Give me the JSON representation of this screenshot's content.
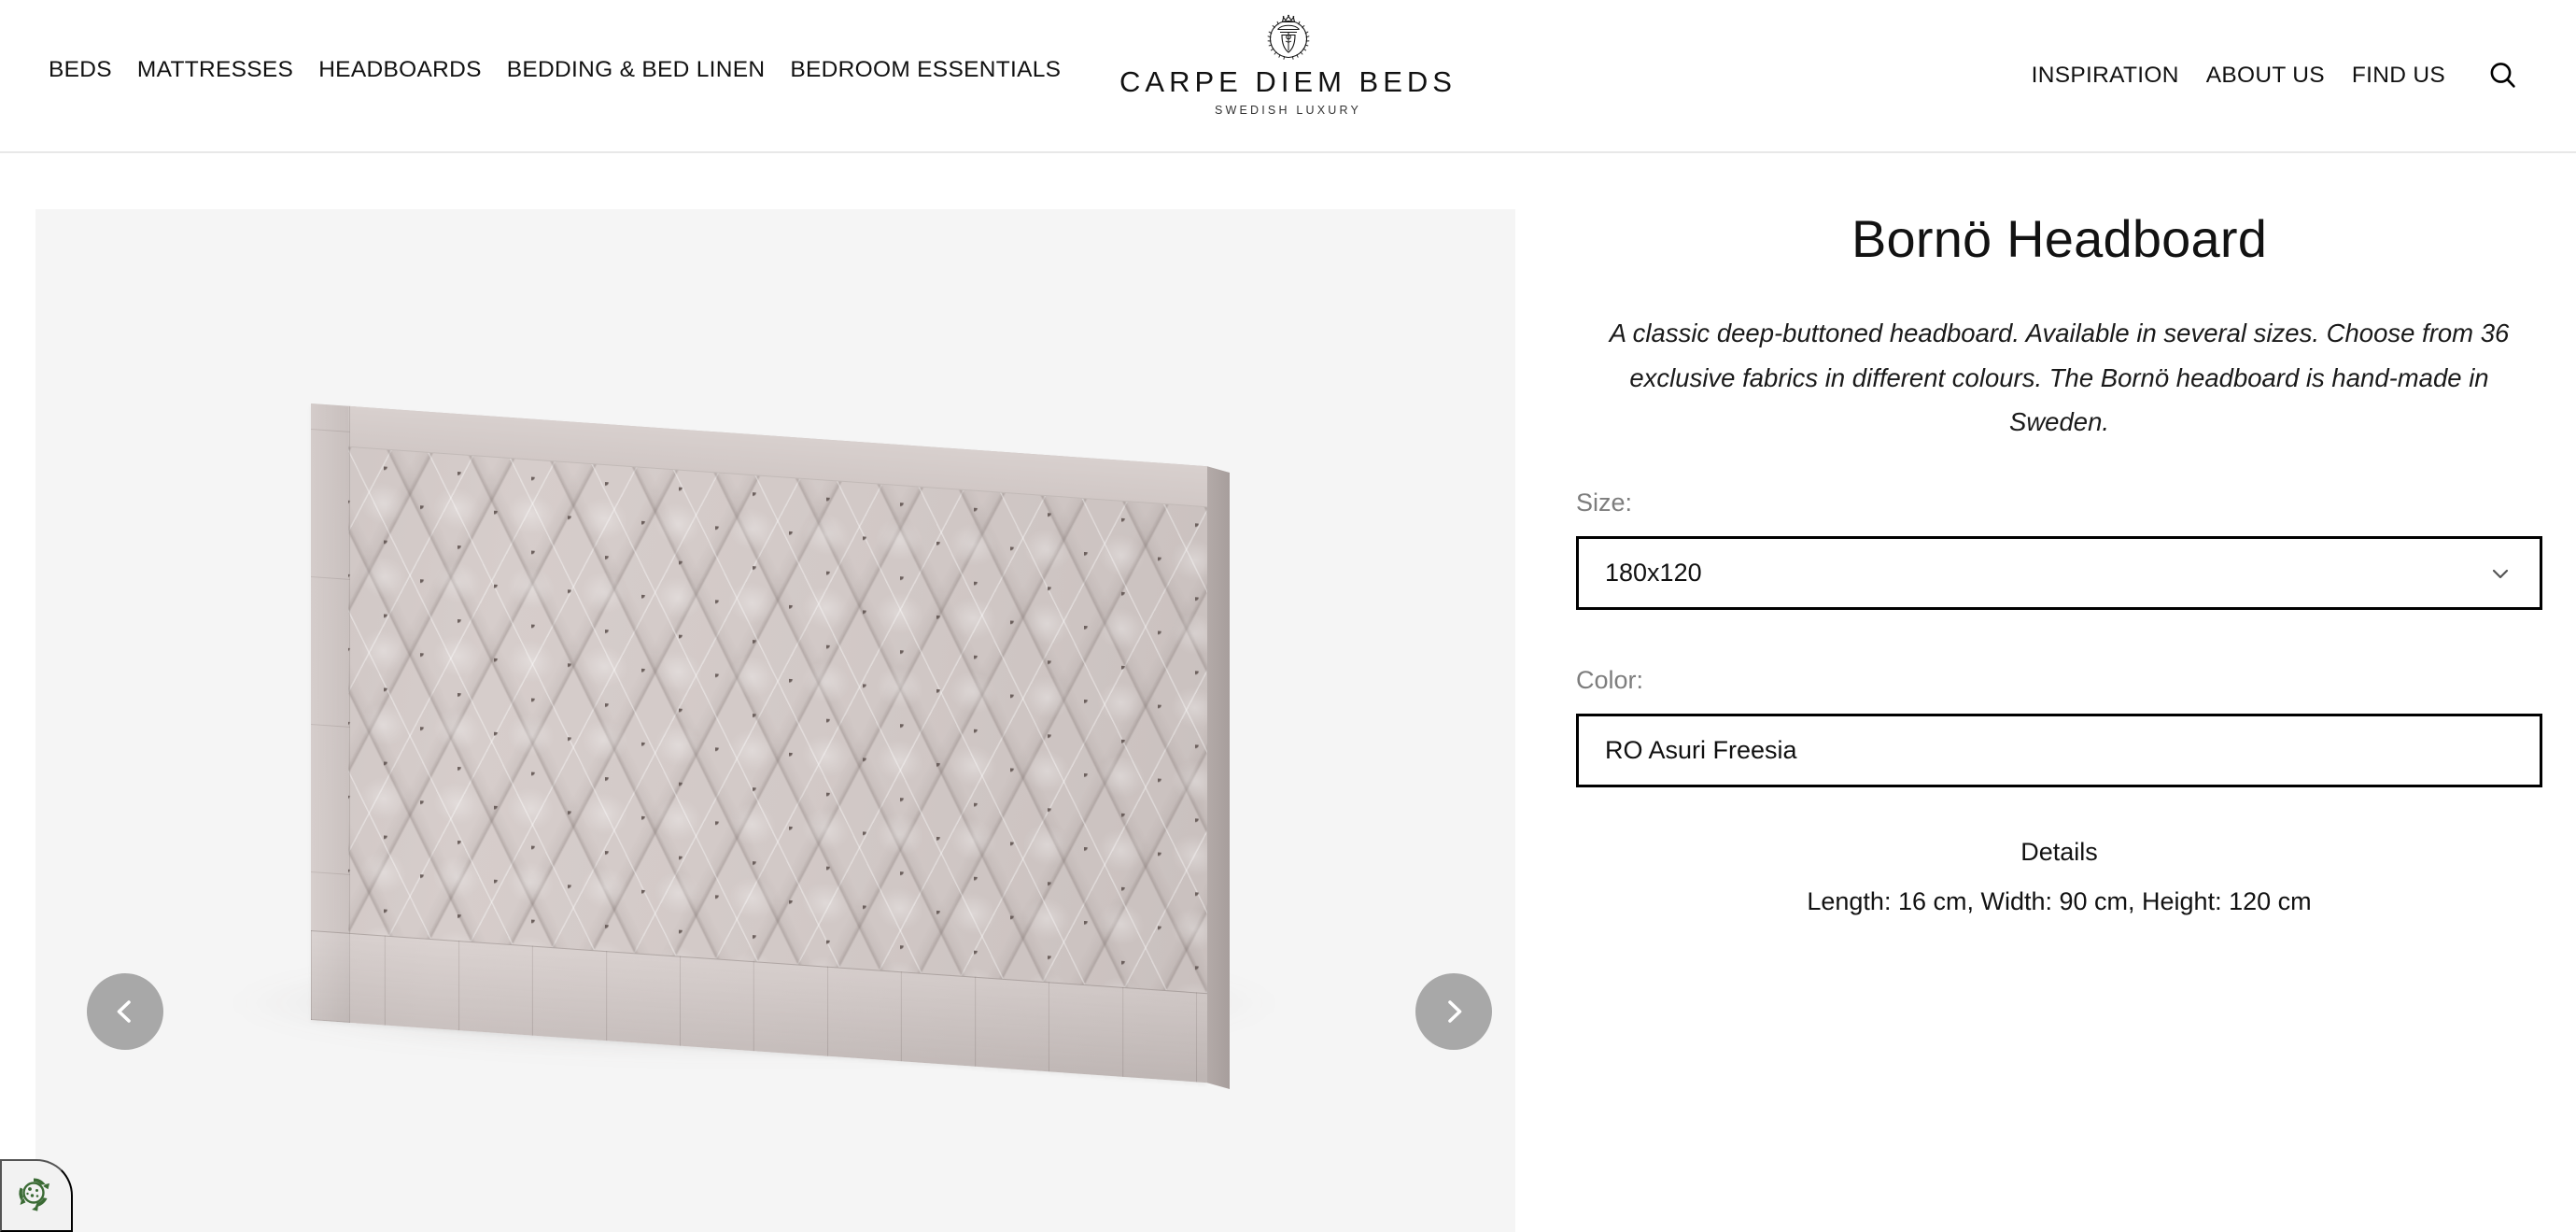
{
  "header": {
    "nav_left": [
      {
        "label": "BEDS"
      },
      {
        "label": "MATTRESSES"
      },
      {
        "label": "HEADBOARDS"
      },
      {
        "label": "BEDDING & BED LINEN"
      },
      {
        "label": "BEDROOM ESSENTIALS"
      }
    ],
    "nav_right": [
      {
        "label": "INSPIRATION"
      },
      {
        "label": "ABOUT US"
      },
      {
        "label": "FIND US"
      }
    ],
    "search_icon": "search-icon",
    "logo": {
      "emblem": "crown-laurel-wreath-emblem",
      "name": "CARPE DIEM BEDS",
      "tagline": "SWEDISH LUXURY"
    },
    "border_color": "#e8e8e8"
  },
  "gallery": {
    "background": "#f5f5f5",
    "image_alt": "Bornö deep-buttoned tufted headboard in light taupe fabric",
    "fabric_color": "#d2c9c7",
    "prev_icon": "chevron-left-icon",
    "next_icon": "chevron-right-icon",
    "arrow_background": "#a8a8a8"
  },
  "product": {
    "title": "Bornö Headboard",
    "description": "A classic deep-buttoned headboard. Available in several sizes. Choose from 36 exclusive fabrics in different colours. The Bornö headboard is hand-made in Sweden.",
    "size": {
      "label": "Size:",
      "value": "180x120",
      "chevron_icon": "chevron-down-icon"
    },
    "color": {
      "label": "Color:",
      "value": "RO Asuri Freesia"
    },
    "details": {
      "heading": "Details",
      "text": "Length: 16 cm, Width: 90 cm, Height: 120 cm"
    }
  },
  "cookie_widget": {
    "icon": "cookie-consent-icon",
    "color": "#3b6b35"
  }
}
